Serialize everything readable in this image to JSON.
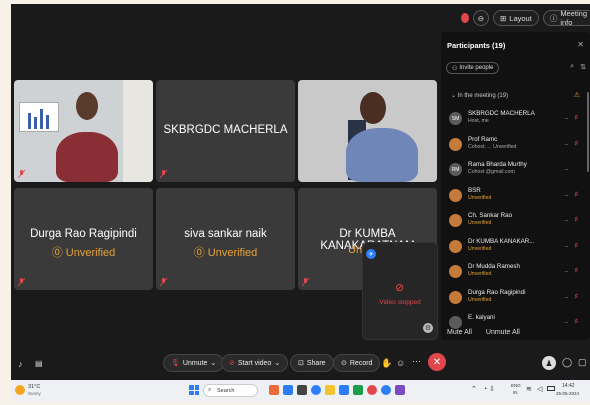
{
  "topbar": {
    "layout_label": "Layout",
    "meeting_info_label": "Meeting info"
  },
  "tiles": [
    {
      "type": "video"
    },
    {
      "type": "name",
      "name": "SKBRGDC MACHERLA"
    },
    {
      "type": "video"
    },
    {
      "type": "name",
      "name": "Durga Rao Ragipindi",
      "status": "Unverified"
    },
    {
      "type": "name",
      "name": "siva sankar naik",
      "status": "Unverified"
    },
    {
      "type": "name",
      "name": "Dr KUMBA KANAKARATNAM",
      "status": "Un"
    }
  ],
  "self_view": {
    "status": "Video stopped"
  },
  "participants_panel": {
    "title": "Participants (19)",
    "invite_label": "Invite people",
    "section_label": "In the meeting (19)",
    "participants": [
      {
        "initials": "SM",
        "name": "SKBRGDC MACHERLA",
        "sub": "Host, me",
        "color": "#5b5b5b"
      },
      {
        "initials": "",
        "name": "Prof Ramc",
        "sub": "Cohost, ...  Unverified",
        "color": "#c47a3a"
      },
      {
        "initials": "RM",
        "name": "Rama Bharda Murthy",
        "sub": "Cohost  @gmail.com",
        "color": "#5b5b5b"
      },
      {
        "initials": "",
        "name": "BSR",
        "sub": "Unverified",
        "color": "#c47a3a"
      },
      {
        "initials": "",
        "name": "Ch. Sankar Rao",
        "sub": "Unverified",
        "color": "#c47a3a"
      },
      {
        "initials": "",
        "name": "Dr KUMBA KANAKAR...",
        "sub": "Unverified",
        "color": "#c47a3a"
      },
      {
        "initials": "",
        "name": "Dr Mudda Ramesh",
        "sub": "Unverified",
        "color": "#c47a3a"
      },
      {
        "initials": "",
        "name": "Durga Rao Ragipindi",
        "sub": "Unverified",
        "color": "#c47a3a"
      },
      {
        "initials": "",
        "name": "E. kalyani",
        "sub": "",
        "color": "#5b5b5b"
      }
    ],
    "mute_all_label": "Mute All",
    "unmute_all_label": "Unmute All"
  },
  "toolbar": {
    "unmute_label": "Unmute",
    "start_video_label": "Start video",
    "share_label": "Share",
    "record_label": "Record"
  },
  "taskbar": {
    "weather_temp": "31°C",
    "weather_desc": "Sunny",
    "search_placeholder": "Search",
    "lang": "ENG",
    "lang_sub": "IN",
    "time": "14:42",
    "date": "25-05-2024"
  }
}
